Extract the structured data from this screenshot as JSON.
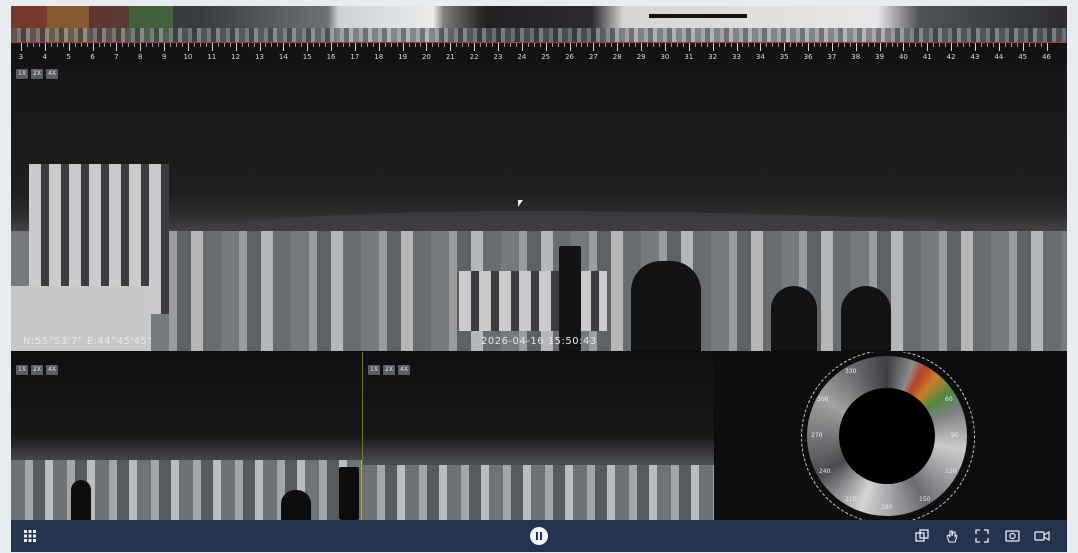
{
  "ruler": {
    "labels": [
      "3",
      "4",
      "5",
      "6",
      "7",
      "8",
      "9",
      "10",
      "11",
      "12",
      "13",
      "14",
      "15",
      "16",
      "17",
      "18",
      "19",
      "20",
      "21",
      "22",
      "23",
      "24",
      "25",
      "26",
      "27",
      "28",
      "29",
      "30",
      "31",
      "32",
      "33",
      "34",
      "35",
      "36",
      "37",
      "38",
      "39",
      "40",
      "41",
      "42",
      "43",
      "44",
      "45",
      "46"
    ]
  },
  "zoom_levels": [
    "1X",
    "2X",
    "4X"
  ],
  "main_view": {
    "coordinates": "N:55°53'7\" E:44°45'45\"",
    "timestamp": "2026-04-16 15:50:43"
  },
  "compass": {
    "labels": [
      "270",
      "300",
      "330",
      "60",
      "90",
      "120",
      "150",
      "180",
      "210",
      "240"
    ]
  },
  "colors": {
    "toolbar_bg": "#24344f",
    "ruler_accent": "#b23a2a",
    "heat_red": "#b5422a",
    "heat_orange": "#d07a2a",
    "heat_green": "#4f8a3e"
  },
  "toolbar": {
    "left_icon": "grid-menu-icon",
    "center_icon": "pause-icon",
    "right_icons": [
      "layers-icon",
      "ptz-hand-icon",
      "fullscreen-icon",
      "snapshot-icon",
      "record-video-icon"
    ]
  }
}
